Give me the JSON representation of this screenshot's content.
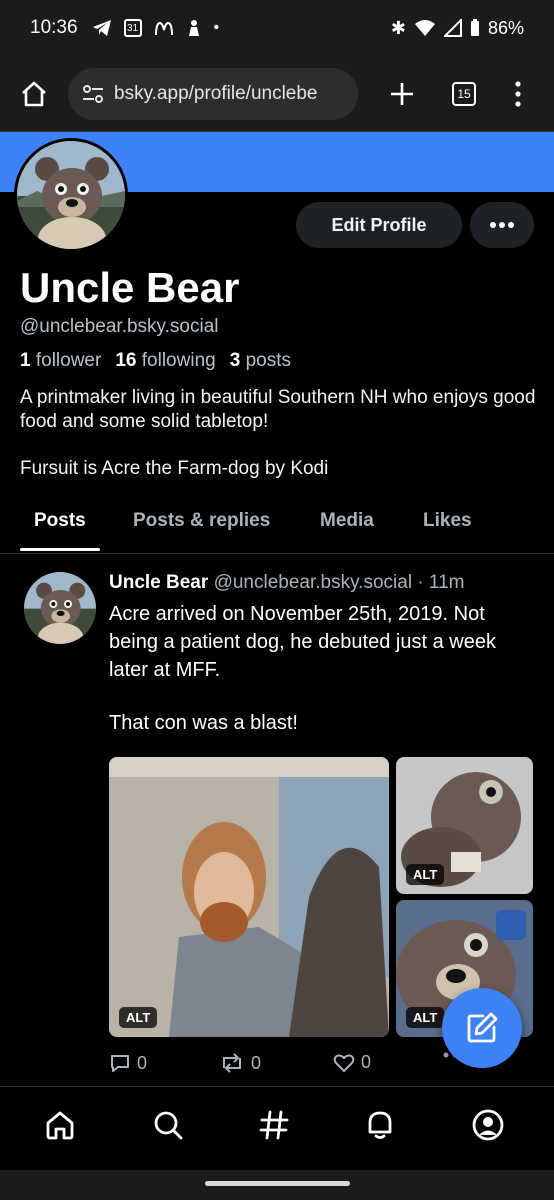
{
  "status_bar": {
    "time": "10:36",
    "calendar_day": "31",
    "battery": "86%"
  },
  "browser": {
    "url": "bsky.app/profile/unclebe",
    "tab_count": "15"
  },
  "profile": {
    "display_name": "Uncle Bear",
    "handle": "@unclebear.bsky.social",
    "followers_count": "1",
    "followers_label": "follower",
    "following_count": "16",
    "following_label": "following",
    "posts_count": "3",
    "posts_label": "posts",
    "bio_line1": "A printmaker living in beautiful Southern NH who enjoys good food and some solid tabletop!",
    "bio_line2": "Fursuit is Acre the Farm-dog by Kodi",
    "edit_label": "Edit Profile",
    "banner_color": "#3c82f6"
  },
  "tabs": [
    {
      "label": "Posts",
      "active": true
    },
    {
      "label": "Posts & replies",
      "active": false
    },
    {
      "label": "Media",
      "active": false
    },
    {
      "label": "Likes",
      "active": false
    }
  ],
  "post": {
    "author_name": "Uncle Bear",
    "author_handle": "@unclebear.bsky.social",
    "time_ago": "· 11m",
    "text": "Acre arrived on November 25th, 2019. Not being a patient dog, he debuted just a week later at MFF.",
    "text2": "That con was a blast!",
    "alt_label": "ALT",
    "reply_count": "0",
    "repost_count": "0",
    "like_count": "0"
  },
  "colors": {
    "accent": "#3c82f6",
    "background": "#000000",
    "muted_text": "#aab3bb"
  },
  "nav": [
    "home-icon",
    "search-icon",
    "feeds-hash-icon",
    "notifications-bell-icon",
    "profile-icon"
  ]
}
